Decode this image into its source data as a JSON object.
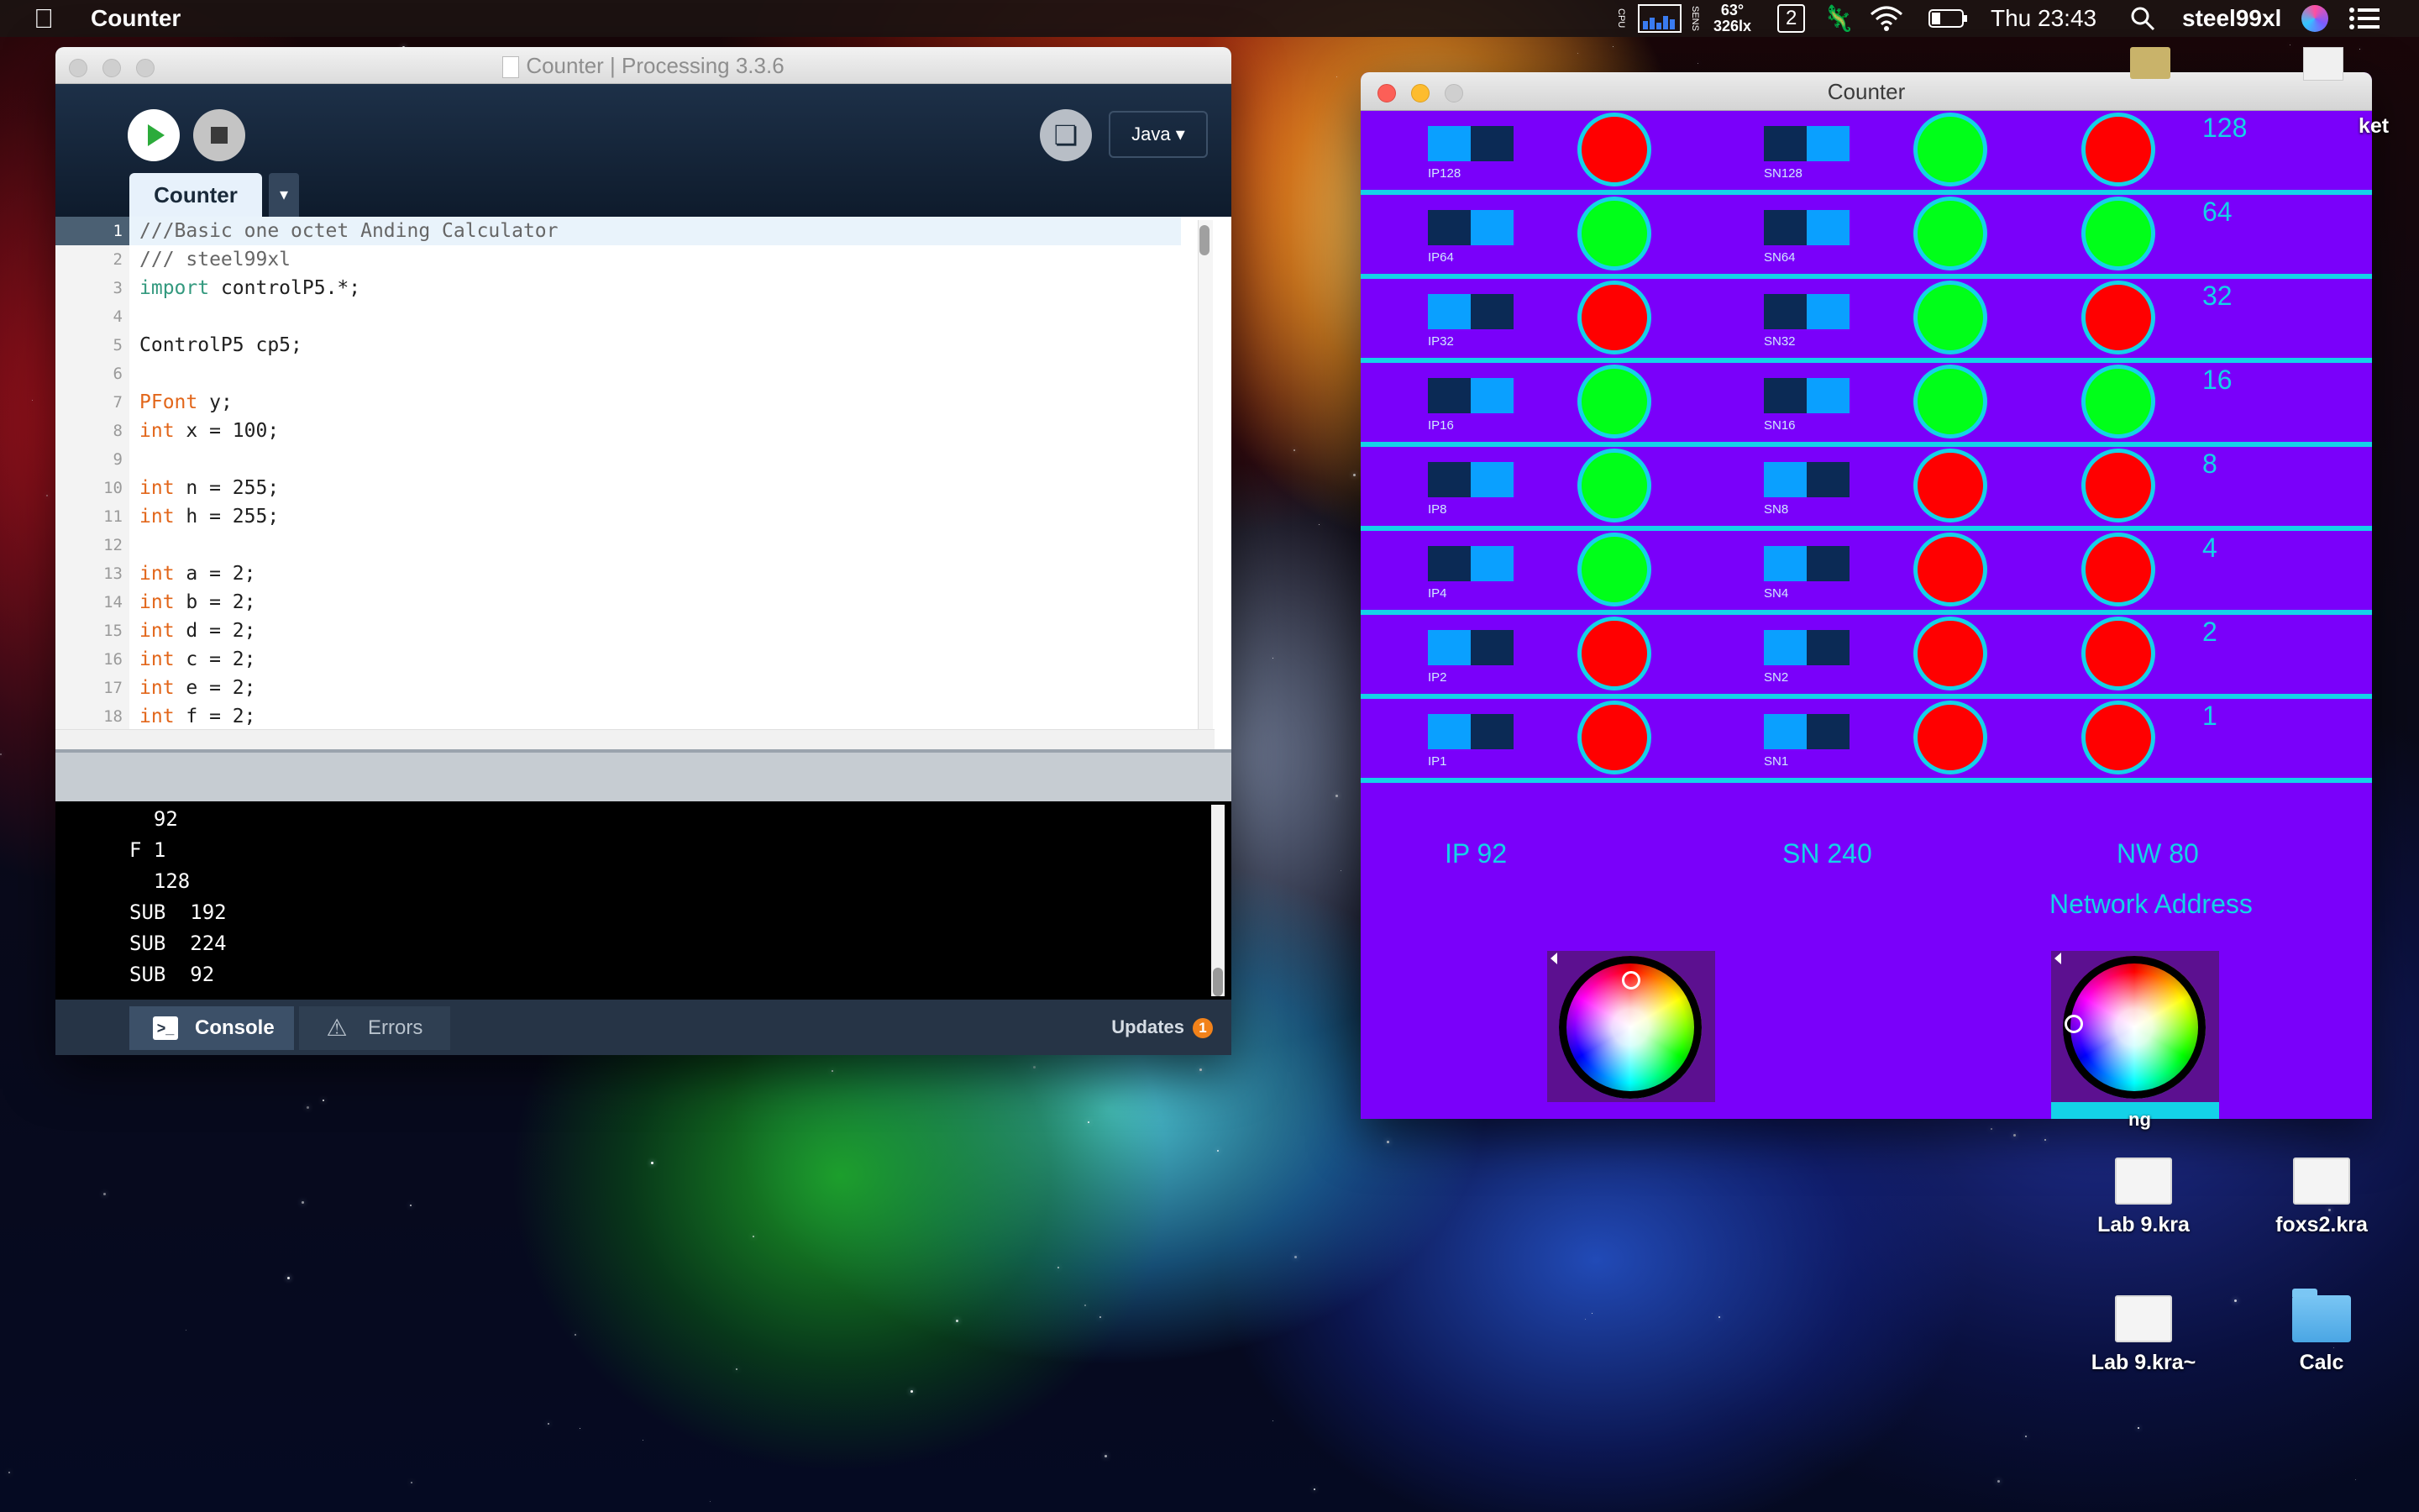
{
  "menubar": {
    "app_name": "Counter",
    "cpu_label": "CPU",
    "sens_label": "SENS",
    "temperature": "63°",
    "lux": "326lx",
    "desktop_number": "2",
    "clock": "Thu 23:43",
    "user": "steel99xl"
  },
  "ide": {
    "title": "Counter | Processing 3.3.6",
    "mode": "Java ▾",
    "tab": "Counter",
    "tab_menu": "▾",
    "code": [
      {
        "n": "1",
        "parts": [
          {
            "t": "///Basic one octet Anding Calculator",
            "c": "cmt"
          }
        ]
      },
      {
        "n": "2",
        "parts": [
          {
            "t": "/// steel99xl",
            "c": "cmt"
          }
        ]
      },
      {
        "n": "3",
        "parts": [
          {
            "t": "import",
            "c": "kw-green"
          },
          {
            "t": " controlP5.*;",
            "c": ""
          }
        ]
      },
      {
        "n": "4",
        "parts": []
      },
      {
        "n": "5",
        "parts": [
          {
            "t": "ControlP5 cp5;",
            "c": ""
          }
        ]
      },
      {
        "n": "6",
        "parts": []
      },
      {
        "n": "7",
        "parts": [
          {
            "t": "PFont",
            "c": "kw"
          },
          {
            "t": " y;",
            "c": ""
          }
        ]
      },
      {
        "n": "8",
        "parts": [
          {
            "t": "int",
            "c": "kw"
          },
          {
            "t": " x = 100;",
            "c": ""
          }
        ]
      },
      {
        "n": "9",
        "parts": []
      },
      {
        "n": "10",
        "parts": [
          {
            "t": "int",
            "c": "kw"
          },
          {
            "t": " n = 255;",
            "c": ""
          }
        ]
      },
      {
        "n": "11",
        "parts": [
          {
            "t": "int",
            "c": "kw"
          },
          {
            "t": " h = 255;",
            "c": ""
          }
        ]
      },
      {
        "n": "12",
        "parts": []
      },
      {
        "n": "13",
        "parts": [
          {
            "t": "int",
            "c": "kw"
          },
          {
            "t": " a = 2;",
            "c": ""
          }
        ]
      },
      {
        "n": "14",
        "parts": [
          {
            "t": "int",
            "c": "kw"
          },
          {
            "t": " b = 2;",
            "c": ""
          }
        ]
      },
      {
        "n": "15",
        "parts": [
          {
            "t": "int",
            "c": "kw"
          },
          {
            "t": " d = 2;",
            "c": ""
          }
        ]
      },
      {
        "n": "16",
        "parts": [
          {
            "t": "int",
            "c": "kw"
          },
          {
            "t": " c = 2;",
            "c": ""
          }
        ]
      },
      {
        "n": "17",
        "parts": [
          {
            "t": "int",
            "c": "kw"
          },
          {
            "t": " e = 2;",
            "c": ""
          }
        ]
      },
      {
        "n": "18",
        "parts": [
          {
            "t": "int",
            "c": "kw"
          },
          {
            "t": " f = 2;",
            "c": ""
          }
        ]
      }
    ],
    "console_lines": [
      "  92",
      "F 1",
      "  128",
      "SUB  192",
      "SUB  224",
      "SUB  92"
    ],
    "footer": {
      "console_tab": "Console",
      "errors_tab": "Errors",
      "updates_label": "Updates",
      "updates_count": "1"
    }
  },
  "sketch": {
    "title": "Counter",
    "colors": {
      "on": "#00ff19",
      "off": "#ff0000",
      "ring": "#14d2e8",
      "bg": "#7a00fa",
      "toggle_light": "#0aa0ff",
      "toggle_dark": "#0b2a55"
    },
    "rows": [
      {
        "ip_label": "IP128",
        "ip_toggle": "left",
        "ip_led": "off",
        "sn_label": "SN128",
        "sn_toggle": "right",
        "sn_led": "on",
        "nw_led": "off",
        "bit": "128"
      },
      {
        "ip_label": "IP64",
        "ip_toggle": "right",
        "ip_led": "on",
        "sn_label": "SN64",
        "sn_toggle": "right",
        "sn_led": "on",
        "nw_led": "on",
        "bit": "64"
      },
      {
        "ip_label": "IP32",
        "ip_toggle": "left",
        "ip_led": "off",
        "sn_label": "SN32",
        "sn_toggle": "right",
        "sn_led": "on",
        "nw_led": "off",
        "bit": "32"
      },
      {
        "ip_label": "IP16",
        "ip_toggle": "right",
        "ip_led": "on",
        "sn_label": "SN16",
        "sn_toggle": "right",
        "sn_led": "on",
        "nw_led": "on",
        "bit": "16"
      },
      {
        "ip_label": "IP8",
        "ip_toggle": "right",
        "ip_led": "on",
        "sn_label": "SN8",
        "sn_toggle": "left",
        "sn_led": "off",
        "nw_led": "off",
        "bit": "8"
      },
      {
        "ip_label": "IP4",
        "ip_toggle": "right",
        "ip_led": "on",
        "sn_label": "SN4",
        "sn_toggle": "left",
        "sn_led": "off",
        "nw_led": "off",
        "bit": "4"
      },
      {
        "ip_label": "IP2",
        "ip_toggle": "left",
        "ip_led": "off",
        "sn_label": "SN2",
        "sn_toggle": "left",
        "sn_led": "off",
        "nw_led": "off",
        "bit": "2"
      },
      {
        "ip_label": "IP1",
        "ip_toggle": "left",
        "ip_led": "off",
        "sn_label": "SN1",
        "sn_toggle": "left",
        "sn_led": "off",
        "nw_led": "off",
        "bit": "1"
      }
    ],
    "ip_result": "IP 92",
    "sn_result": "SN 240",
    "nw_result": "NW 80",
    "network_caption": "Network Address"
  },
  "desktop": {
    "partial_label_top": "ket",
    "partial_label_mid": "ng",
    "icons": [
      {
        "label": "Lab 9.kra",
        "kind": "thumb"
      },
      {
        "label": "foxs2.kra",
        "kind": "thumb"
      },
      {
        "label": "Lab 9.kra~",
        "kind": "thumb"
      },
      {
        "label": "Calc",
        "kind": "folder"
      }
    ]
  }
}
